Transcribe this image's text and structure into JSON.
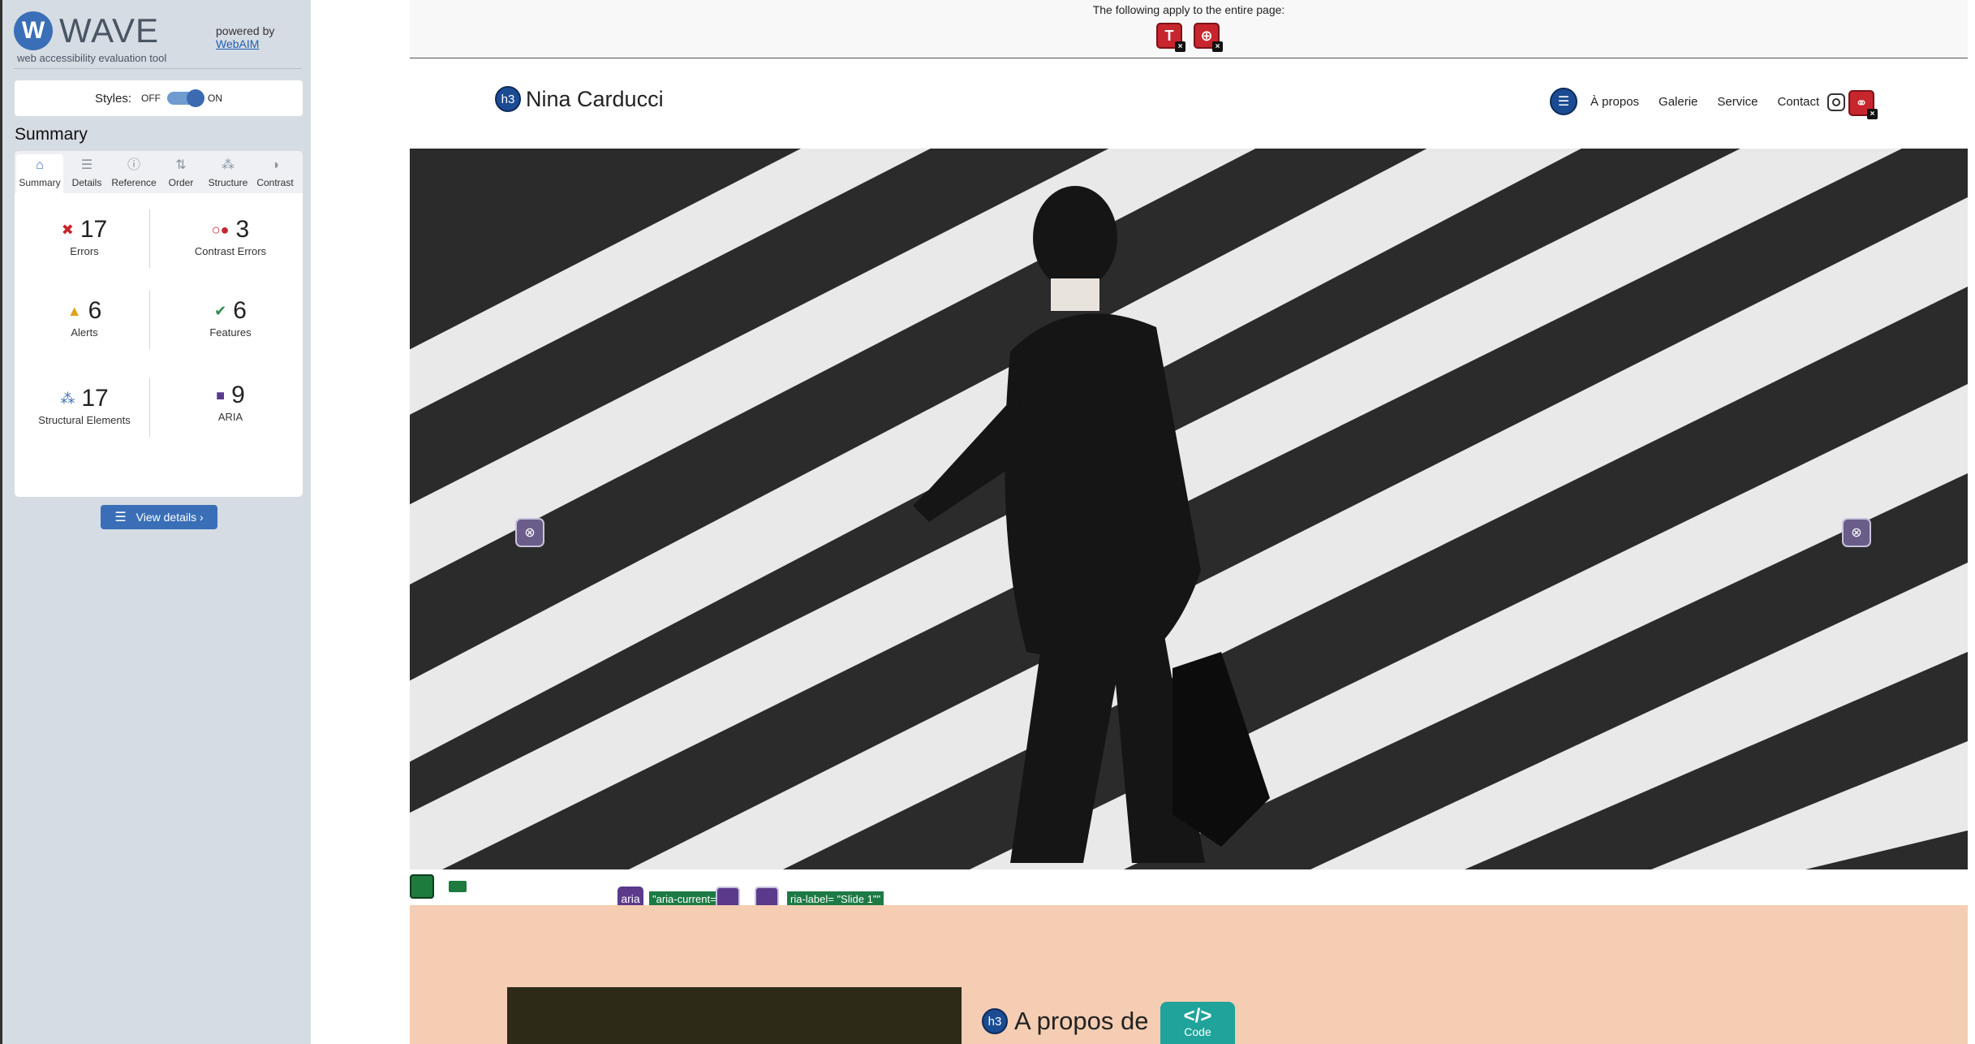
{
  "sidebar": {
    "logo_letter": "W",
    "title": "WAVE",
    "subtitle": "web accessibility evaluation tool",
    "powered_by": "powered by",
    "powered_link": "WebAIM",
    "styles_label": "Styles:",
    "styles_off": "OFF",
    "styles_on": "ON",
    "summary_heading": "Summary",
    "tabs": [
      {
        "label": "Summary",
        "icon": "home-icon"
      },
      {
        "label": "Details",
        "icon": "list-icon"
      },
      {
        "label": "Reference",
        "icon": "info-icon"
      },
      {
        "label": "Order",
        "icon": "order-icon"
      },
      {
        "label": "Structure",
        "icon": "structure-icon"
      },
      {
        "label": "Contrast",
        "icon": "contrast-icon"
      }
    ],
    "stats": {
      "errors": {
        "value": "17",
        "label": "Errors"
      },
      "contrast": {
        "value": "3",
        "label": "Contrast Errors"
      },
      "alerts": {
        "value": "6",
        "label": "Alerts"
      },
      "features": {
        "value": "6",
        "label": "Features"
      },
      "structural": {
        "value": "17",
        "label": "Structural Elements"
      },
      "aria": {
        "value": "9",
        "label": "ARIA"
      }
    },
    "view_details": "View details ›"
  },
  "page": {
    "notice": "The following apply to the entire page:",
    "brand_badge": "h3",
    "brand": "Nina Carducci",
    "nav": [
      "À propos",
      "Galerie",
      "Service",
      "Contact"
    ],
    "aria_badge": "aria",
    "aria_text1": "\"aria-current= tru",
    "aria_text2": "ria-label= \"Slide 1\"\"",
    "about_badge": "h3",
    "about_title": "A propos de",
    "code_label": "Code",
    "code_symbol": "</>"
  }
}
